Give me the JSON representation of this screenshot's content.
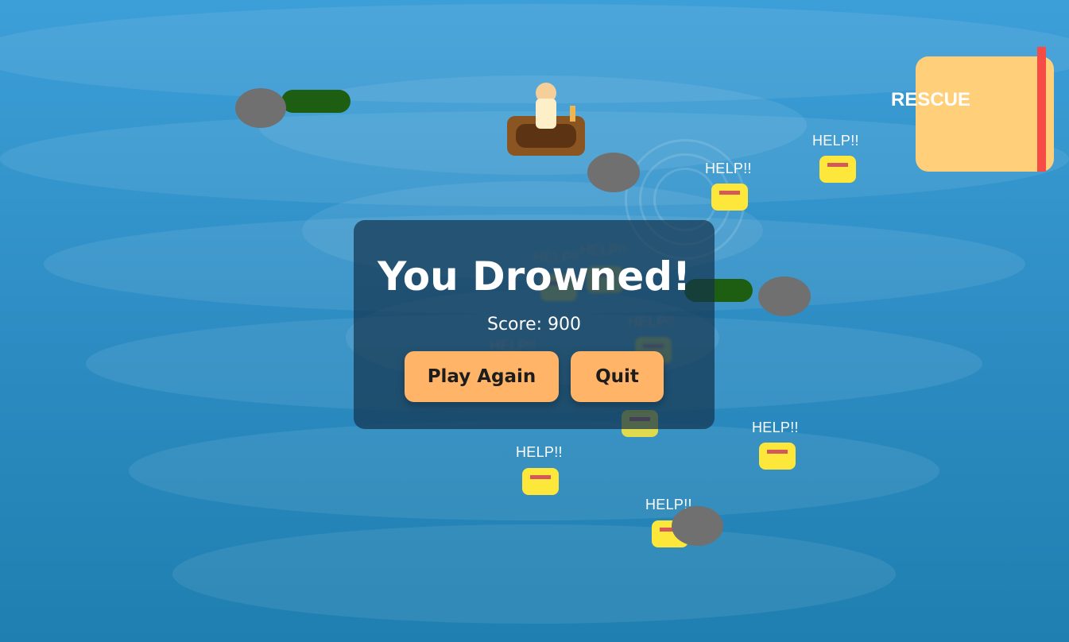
{
  "game": {
    "rescue_label": "RESCUE",
    "help_text": "HELP!!"
  },
  "dialog": {
    "title": "You Drowned!",
    "score_text": "Score: 900",
    "play_again_label": "Play Again",
    "quit_label": "Quit"
  },
  "colors": {
    "water": "#2f8fc6",
    "rock": "#707070",
    "log": "#1e5e12",
    "survivor": "#fde73a",
    "boat": "#8a5520",
    "rescue_zone": "#ffcf7a",
    "rescue_flag": "#f74c46",
    "button": "#ffb468"
  }
}
